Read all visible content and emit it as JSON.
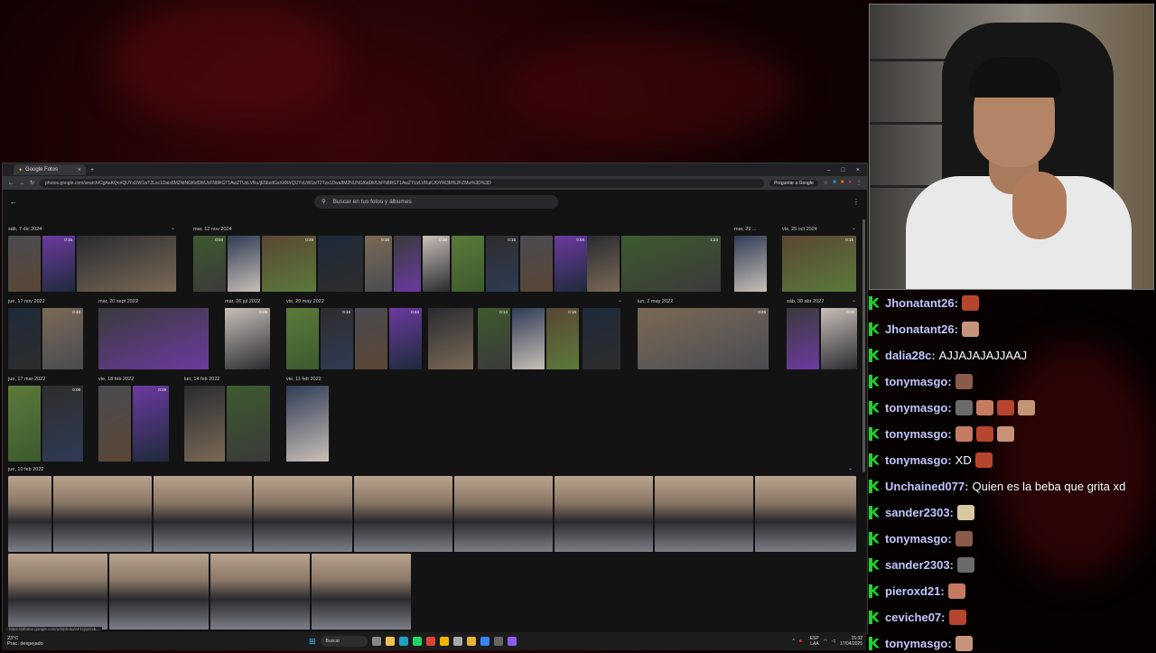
{
  "browser": {
    "tab_title": "Google Fotos",
    "url": "photos.google.com/search/CgAaKQonQUYxUW1wT2Lsc1Dalx8M2NtNGl6dDlt/UxFN8RGT1AwZTUzLVRu/jE5bzdGsXXR/rQUYxUW1wT2Tzs1Dwa8M2NUNGl6dDlt/UxFN8RGT1AwZTUzLVRuKJOYlR3M%2FZMw%3D%3D",
    "ask_google": "Preguntar a Google",
    "search_placeholder": "Buscar en tus fotos y álbumes",
    "status_url": "https://photos.google.com/u/0/photo/AF1QipOxb..."
  },
  "gallery": {
    "date_labels": [
      "sáb, 7 dic 2024",
      "mar, 12 nov 2024",
      "mar, 29 ...",
      "vie, 25 oct 2024",
      "jue, 17 nov 2022",
      "mar, 20 sept 2022",
      "mar, 26 jul 2022",
      "vie, 20 may 2022",
      "lun, 2 may 2022",
      "sáb, 30 abr 2022",
      "jue, 17 mar 2022",
      "vie, 18 feb 2022",
      "lun, 14 feb 2022",
      "vie, 11 feb 2022",
      "jue, 10 feb 2022"
    ],
    "durations": [
      "0:16",
      "0:04",
      "0:29",
      "0:16",
      "0:38",
      "0:15",
      "0:04",
      "1:24",
      "0:15",
      "0:42",
      "0:06",
      "0:16",
      "0:44",
      "0:14",
      "0:16",
      "0:26",
      "0:20",
      "0:09",
      "0:19"
    ]
  },
  "taskbar": {
    "weather_temp": "23°C",
    "weather_desc": "Prac. despejado",
    "search_label": "Buscar",
    "time": "15:32",
    "date": "17/04/2025",
    "lang": "ESP LAA"
  },
  "chat": {
    "messages": [
      {
        "user": "Jhonatant26:",
        "text": ""
      },
      {
        "user": "Jhonatant26:",
        "text": ""
      },
      {
        "user": "dalia28c:",
        "text": "AJJAJAJAJJAAJ"
      },
      {
        "user": "tonymasgo:",
        "text": ""
      },
      {
        "user": "tonymasgo:",
        "text": ""
      },
      {
        "user": "tonymasgo:",
        "text": ""
      },
      {
        "user": "tonymasgo:",
        "text": "XD"
      },
      {
        "user": "Unchained077:",
        "text": "Quien es la beba que grita xd"
      },
      {
        "user": "sander2303:",
        "text": ""
      },
      {
        "user": "tonymasgo:",
        "text": ""
      },
      {
        "user": "sander2303:",
        "text": ""
      },
      {
        "user": "pieroxd21:",
        "text": ""
      },
      {
        "user": "ceviche07:",
        "text": ""
      },
      {
        "user": "tonymasgo:",
        "text": ""
      }
    ]
  },
  "colors": {
    "accent_badge": "#1cd52b",
    "username": "#c4c6ff",
    "bg_red": "#3a0508"
  }
}
